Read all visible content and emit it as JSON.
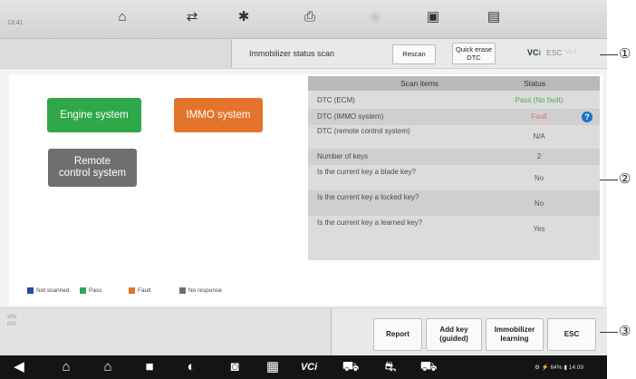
{
  "status_bar": {
    "time": "13:41"
  },
  "top_icons": [
    {
      "name": "home-icon",
      "glyph": "⌂"
    },
    {
      "name": "vehicle-swap-icon",
      "glyph": "⇄"
    },
    {
      "name": "settings-gear-icon",
      "glyph": "✱"
    },
    {
      "name": "print-icon",
      "glyph": "⎙"
    },
    {
      "name": "disabled-function-icon",
      "glyph": "◉"
    },
    {
      "name": "save-icon",
      "glyph": "▣"
    },
    {
      "name": "data-logging-icon",
      "glyph": "▤"
    }
  ],
  "subheader": {
    "status_text": "Immobilizer status scan",
    "rescan_label": "Rescan",
    "quick_erase_line1": "Quick erase",
    "quick_erase_line2": "DTC",
    "vci_label": "VC",
    "vci_badge": "i",
    "esc_tag": "ESC",
    "version": "V1.0"
  },
  "systems": {
    "engine": "Engine system",
    "immo": "IMMO system",
    "remote_line1": "Remote",
    "remote_line2": "control system"
  },
  "scan_table": {
    "header_item": "Scan items",
    "header_status": "Status",
    "rows": [
      {
        "item": "DTC (ECM)",
        "status": "Pass (No fault)",
        "status_color": "#4caf50"
      },
      {
        "item": "DTC (IMMO system)",
        "status": "Fault",
        "status_color": "#e57373"
      },
      {
        "item": "DTC (remote control system)",
        "status": "N/A",
        "status_color": "#555555"
      },
      {
        "item": "Number of keys",
        "status": "2",
        "status_color": "#555555"
      },
      {
        "item": "Is the current key a blade key?",
        "status": "No",
        "status_color": "#555555"
      },
      {
        "item": "Is the current key a locked key?",
        "status": "No",
        "status_color": "#555555"
      },
      {
        "item": "Is the current key a learned key?",
        "status": "Yes",
        "status_color": "#555555"
      }
    ]
  },
  "legend": [
    {
      "label": "Not scanned",
      "color": "#1f4fa0"
    },
    {
      "label": "Pass",
      "color": "#2fa84a"
    },
    {
      "label": "Fault",
      "color": "#e4742c"
    },
    {
      "label": "No response",
      "color": "#6f6f6f"
    }
  ],
  "bottom_info": {
    "line1": "VIN",
    "line2": "N/A"
  },
  "function_buttons": {
    "report": "Report",
    "add_key_line1": "Add key",
    "add_key_line2": "(guided)",
    "immo_learn_line1": "Immobilizer",
    "immo_learn_line2": "learning",
    "esc": "ESC"
  },
  "nav_icons": [
    {
      "name": "back-arrow-icon",
      "glyph": "◀"
    },
    {
      "name": "maxifix-home-icon",
      "glyph": "⌂"
    },
    {
      "name": "android-home-icon",
      "glyph": "⌂"
    },
    {
      "name": "recent-apps-icon",
      "glyph": "■"
    },
    {
      "name": "browser-icon",
      "glyph": "◐"
    },
    {
      "name": "camera-icon",
      "glyph": "◙"
    },
    {
      "name": "screen-record-icon",
      "glyph": "▦"
    },
    {
      "name": "vci-nav-icon",
      "glyph": "VCi"
    },
    {
      "name": "car-status-icon",
      "glyph": "⛟"
    },
    {
      "name": "car-diagnostics-icon",
      "glyph": "⛐"
    },
    {
      "name": "car-service-icon",
      "glyph": "⛟"
    }
  ],
  "system_tray": {
    "text": "⚙ ⚡ 64% ▮ 14:09"
  },
  "callouts": {
    "one": "①",
    "two": "②",
    "three": "③"
  }
}
